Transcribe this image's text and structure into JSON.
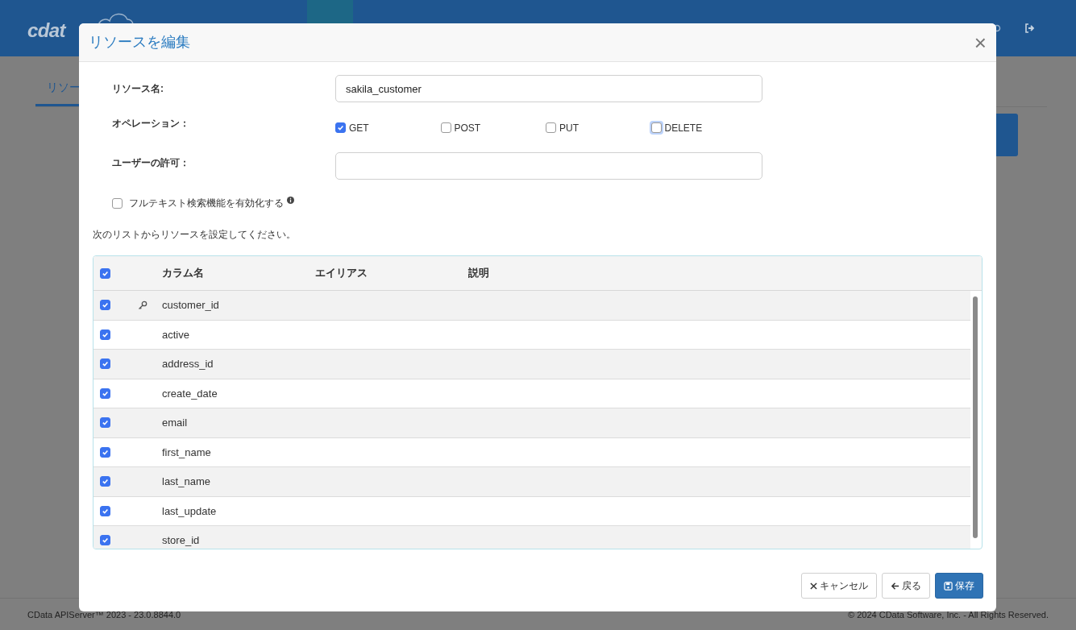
{
  "header": {
    "logo": "cdat"
  },
  "page": {
    "tab": "リソー"
  },
  "footer": {
    "version": "CData APIServer™ 2023 - 23.0.8844.0",
    "copyright": "© 2024 CData Software, Inc. - All Rights Reserved."
  },
  "dialog": {
    "title": "リソースを編集",
    "close": "×",
    "resource_name": {
      "label": "リソース名:",
      "value": "sakila_customer"
    },
    "operations": {
      "label": "オペレーション：",
      "items": [
        {
          "label": "GET",
          "checked": true,
          "focused": false
        },
        {
          "label": "POST",
          "checked": false,
          "focused": false
        },
        {
          "label": "PUT",
          "checked": false,
          "focused": false
        },
        {
          "label": "DELETE",
          "checked": false,
          "focused": true
        }
      ]
    },
    "user_permission": {
      "label": "ユーザーの許可："
    },
    "full_text": {
      "label": "フルテキスト検索機能を有効化する",
      "checked": false
    },
    "instruction": "次のリストからリソースを設定してください。",
    "table": {
      "all_checked": true,
      "columns": [
        "カラム名",
        "エイリアス",
        "説明"
      ],
      "rows": [
        {
          "checked": true,
          "key": true,
          "name": "customer_id"
        },
        {
          "checked": true,
          "key": false,
          "name": "active"
        },
        {
          "checked": true,
          "key": false,
          "name": "address_id"
        },
        {
          "checked": true,
          "key": false,
          "name": "create_date"
        },
        {
          "checked": true,
          "key": false,
          "name": "email"
        },
        {
          "checked": true,
          "key": false,
          "name": "first_name"
        },
        {
          "checked": true,
          "key": false,
          "name": "last_name"
        },
        {
          "checked": true,
          "key": false,
          "name": "last_update"
        },
        {
          "checked": true,
          "key": false,
          "name": "store_id"
        }
      ]
    },
    "buttons": [
      {
        "kind": "cancel",
        "label": "キャンセル"
      },
      {
        "kind": "back",
        "label": "戻る"
      },
      {
        "kind": "save",
        "label": "保存"
      }
    ]
  }
}
